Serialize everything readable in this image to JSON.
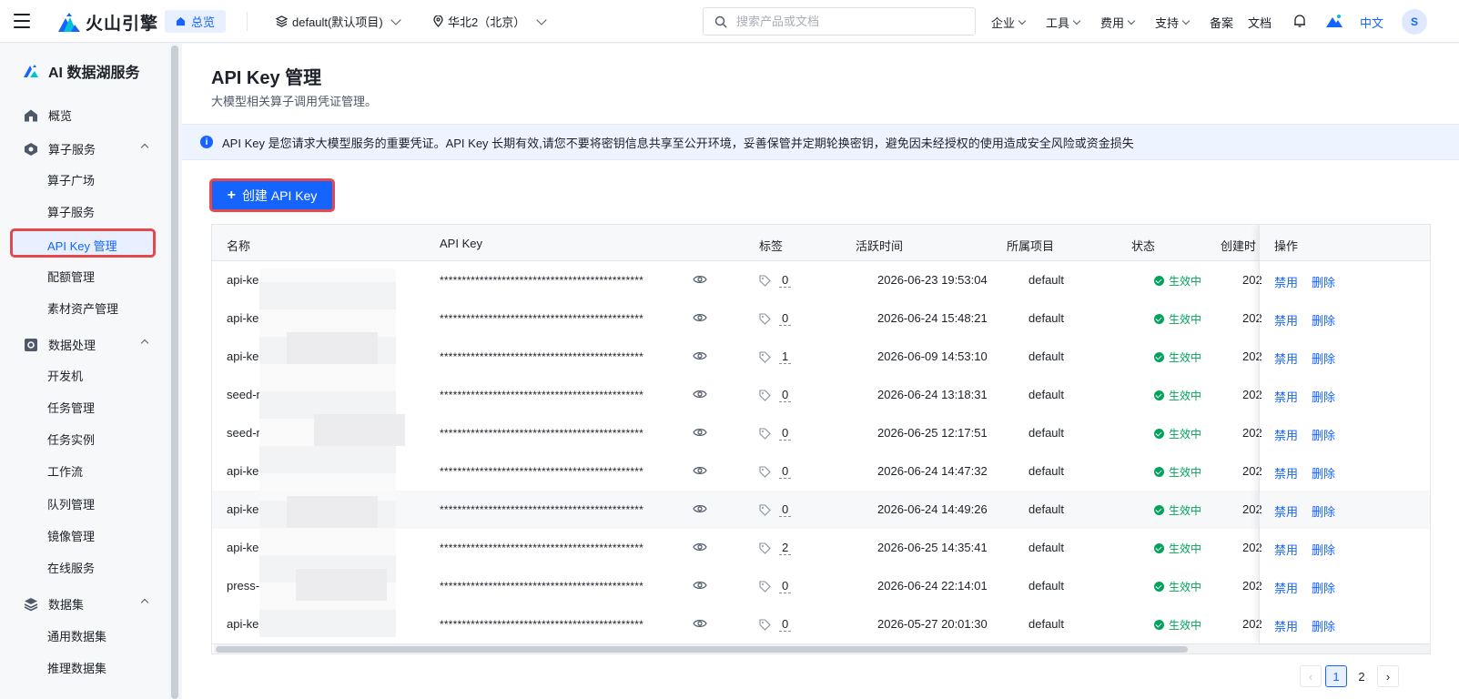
{
  "header": {
    "brand": "火山引擎",
    "overview": "总览",
    "project": "default(默认项目)",
    "region": "华北2（北京）",
    "search_placeholder": "搜索产品或文档",
    "nav": [
      "企业",
      "工具",
      "费用",
      "支持",
      "备案",
      "文档"
    ],
    "lang": "中文",
    "avatar": "S"
  },
  "sidebar": {
    "title": "AI 数据湖服务",
    "overview": "概览",
    "groups": [
      {
        "label": "算子服务",
        "items": [
          "算子广场",
          "算子服务",
          "API Key 管理",
          "配额管理",
          "素材资产管理"
        ]
      },
      {
        "label": "数据处理",
        "items": [
          "开发机",
          "任务管理",
          "任务实例",
          "工作流",
          "队列管理",
          "镜像管理",
          "在线服务"
        ]
      },
      {
        "label": "数据集",
        "items": [
          "通用数据集",
          "推理数据集"
        ]
      }
    ]
  },
  "main": {
    "title": "API Key 管理",
    "subtitle": "大模型相关算子调用凭证管理。",
    "alert": "API Key 是您请求大模型服务的重要凭证。API Key 长期有效,请您不要将密钥信息共享至公开环境，妥善保管并定期轮换密钥，避免因未经授权的使用造成安全风险或资金损失",
    "create_button": "创建 API Key",
    "columns": [
      "名称",
      "API Key",
      "标签",
      "活跃时间",
      "所属项目",
      "状态",
      "创建时间",
      "操作"
    ],
    "masked_key": "**********************************************",
    "rows": [
      {
        "name": "api-ke",
        "tags": "0",
        "active": "2026-06-23 19:53:04",
        "project": "default",
        "status": "生效中",
        "created": "202"
      },
      {
        "name": "api-ke",
        "tags": "0",
        "active": "2026-06-24 15:48:21",
        "project": "default",
        "status": "生效中",
        "created": "202"
      },
      {
        "name": "api-ke",
        "tags": "1",
        "active": "2026-06-09 14:53:10",
        "project": "default",
        "status": "生效中",
        "created": "202"
      },
      {
        "name": "seed-r",
        "tags": "0",
        "active": "2026-06-24 13:18:31",
        "project": "default",
        "status": "生效中",
        "created": "202"
      },
      {
        "name": "seed-r",
        "tags": "0",
        "active": "2026-06-25 12:17:51",
        "project": "default",
        "status": "生效中",
        "created": "202"
      },
      {
        "name": "api-ke",
        "tags": "0",
        "active": "2026-06-24 14:47:32",
        "project": "default",
        "status": "生效中",
        "created": "202"
      },
      {
        "name": "api-ke",
        "tags": "0",
        "active": "2026-06-24 14:49:26",
        "project": "default",
        "status": "生效中",
        "created": "202"
      },
      {
        "name": "api-ke",
        "tags": "2",
        "active": "2026-06-25 14:35:41",
        "project": "default",
        "status": "生效中",
        "created": "202"
      },
      {
        "name": "press-",
        "tags": "0",
        "active": "2026-06-24 22:14:01",
        "project": "default",
        "status": "生效中",
        "created": "202"
      },
      {
        "name": "api-ke",
        "tags": "0",
        "active": "2026-05-27 20:01:30",
        "project": "default",
        "status": "生效中",
        "created": "202"
      }
    ],
    "ops": {
      "disable": "禁用",
      "delete": "删除"
    },
    "pagination": {
      "pages": [
        "1",
        "2"
      ],
      "current": "1"
    }
  },
  "colors": {
    "accent": "#1664ff",
    "success": "#00a35a",
    "highlight": "#e5484d"
  }
}
